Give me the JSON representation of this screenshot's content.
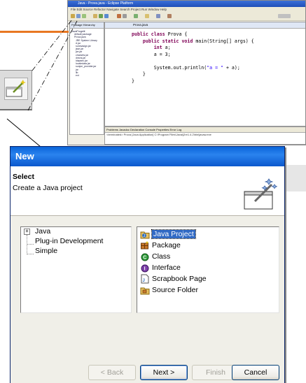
{
  "eclipse": {
    "title": "Java - Prova.java - Eclipse Platform",
    "menu": "File  Edit  Source  Refactor  Navigate  Search  Project  Run  Window  Help",
    "views_tabs": "Package   Hierarchy",
    "editor_tab": "Prova.java",
    "tree": [
      "JavaProgetti",
      "default package",
      "Prova.java",
      "JRE System Library",
      "rt.jar",
      "sunrsasign.jar",
      "jsse.jar",
      "jce.jar",
      "charsets.jar",
      "dnsns.jar",
      "ldapsec.jar",
      "localedata.jar",
      "sunjce_provider.jar",
      "jre",
      "lib",
      "ext"
    ],
    "code": [
      {
        "kw": "public class ",
        "rest": "Prova {"
      },
      {
        "kw": "    public static void ",
        "rest": "main(String[] args) {"
      },
      {
        "kw": "        int ",
        "rest": "a;"
      },
      {
        "kw": "",
        "rest": "        a = 3;"
      },
      {
        "kw": "",
        "rest": ""
      },
      {
        "kw": "",
        "rest": "        System.out.println(",
        "str": "\"a = \"",
        "tail": " + a);"
      },
      {
        "kw": "",
        "rest": "    }"
      },
      {
        "kw": "",
        "rest": "}"
      }
    ],
    "bottom_tabs": "Problems  Javadoc  Declaration  Console  Properties  Error Log",
    "bottom_line": "<terminated> Prova [Java Application] C:\\Program Files\\Java\\j2re1.4.2\\bin\\javaw.exe"
  },
  "dialog": {
    "title": "New",
    "banner_title": "Select",
    "banner_message": "Create a Java project",
    "categories": [
      {
        "label": "Java",
        "expander": "+"
      },
      {
        "label": "Plug-in Development"
      },
      {
        "label": "Simple"
      }
    ],
    "wizards": [
      {
        "label": "Java Project",
        "icon": "java-project-icon",
        "selected": true
      },
      {
        "label": "Package",
        "icon": "package-icon"
      },
      {
        "label": "Class",
        "icon": "class-icon"
      },
      {
        "label": "Interface",
        "icon": "interface-icon"
      },
      {
        "label": "Scrapbook Page",
        "icon": "scrapbook-page-icon"
      },
      {
        "label": "Source Folder",
        "icon": "source-folder-icon"
      }
    ],
    "buttons": {
      "back": "< Back",
      "next": "Next >",
      "finish": "Finish",
      "cancel": "Cancel"
    }
  },
  "colors": {
    "accent_orange": "#e87722",
    "titlebar_blue": "#0a64d8",
    "selection_blue": "#316ac5"
  }
}
